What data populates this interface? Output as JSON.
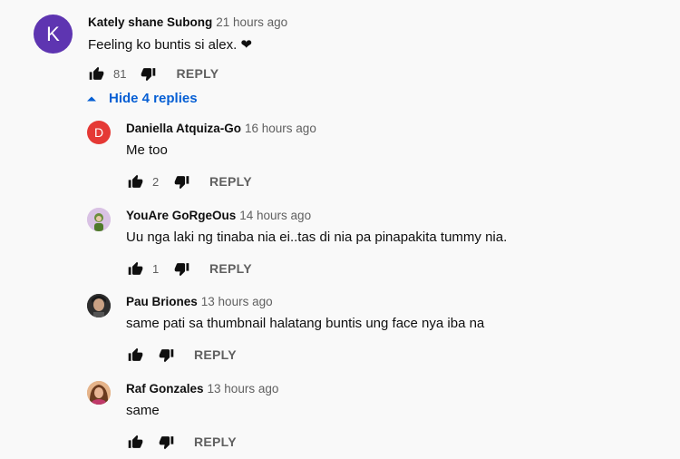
{
  "top_comment": {
    "avatar_letter": "K",
    "author": "Kately shane Subong",
    "time": "21 hours ago",
    "text": "Feeling ko buntis si alex. ❤",
    "likes": "81",
    "reply_label": "REPLY"
  },
  "replies_toggle": {
    "label": "Hide 4 replies",
    "icon": "caret-up-icon"
  },
  "replies": [
    {
      "avatar_letter": "D",
      "author": "Daniella Atquiza-Go",
      "time": "16 hours ago",
      "text": "Me too",
      "likes": "2",
      "reply_label": "REPLY"
    },
    {
      "avatar_letter": "",
      "author": "YouAre GoRgeOus",
      "time": "14 hours ago",
      "text": "Uu nga laki ng tinaba nia ei..tas di nia pa pinapakita tummy nia.",
      "likes": "1",
      "reply_label": "REPLY"
    },
    {
      "avatar_letter": "",
      "author": "Pau Briones",
      "time": "13 hours ago",
      "text": "same pati sa thumbnail halatang buntis ung face nya iba na",
      "likes": "",
      "reply_label": "REPLY"
    },
    {
      "avatar_letter": "",
      "author": "Raf Gonzales",
      "time": "13 hours ago",
      "text": "same",
      "likes": "",
      "reply_label": "REPLY"
    }
  ],
  "colors": {
    "avatar_k": "#5e35b1",
    "avatar_d": "#e53935",
    "link": "#065fd4",
    "secondary_text": "#606060"
  }
}
